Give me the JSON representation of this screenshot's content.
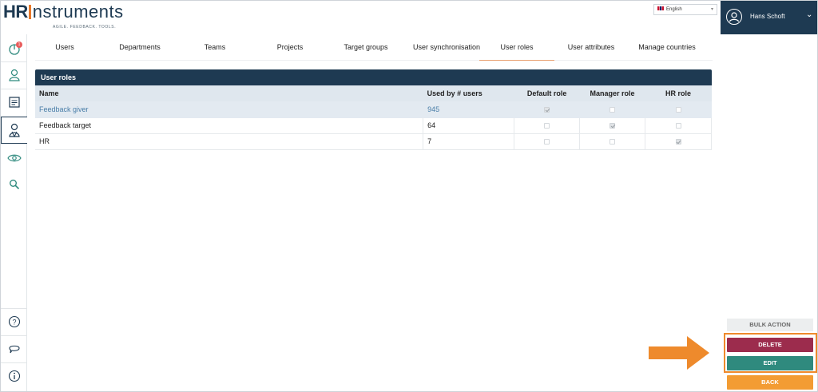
{
  "app": {
    "brand_bold": "HR",
    "brand_light": "nstruments",
    "tagline": "AGILE. FEEDBACK. TOOLS."
  },
  "language": {
    "selected": "English",
    "flag": "uk-flag-icon"
  },
  "user": {
    "name": "Hans Schoft"
  },
  "sidebar": {
    "items": [
      {
        "icon": "dashboard-icon",
        "badge": "1"
      },
      {
        "icon": "user-icon"
      },
      {
        "icon": "list-icon"
      },
      {
        "icon": "users-admin-icon",
        "active": true
      },
      {
        "icon": "eye-icon"
      },
      {
        "icon": "search-icon"
      },
      {
        "icon": "help-icon"
      },
      {
        "icon": "chat-icon"
      },
      {
        "icon": "info-icon"
      }
    ]
  },
  "tabs": [
    {
      "label": "Users"
    },
    {
      "label": "Departments"
    },
    {
      "label": "Teams"
    },
    {
      "label": "Projects"
    },
    {
      "label": "Target groups"
    },
    {
      "label": "User synchronisation"
    },
    {
      "label": "User roles",
      "active": true
    },
    {
      "label": "User attributes"
    },
    {
      "label": "Manage countries"
    }
  ],
  "table": {
    "title": "User roles",
    "columns": {
      "name": "Name",
      "used_by": "Used by # users",
      "default_role": "Default role",
      "manager_role": "Manager role",
      "hr_role": "HR role"
    },
    "rows": [
      {
        "name": "Feedback giver",
        "used_by": "945",
        "default_role": true,
        "manager_role": false,
        "hr_role": false,
        "selected": true
      },
      {
        "name": "Feedback target",
        "used_by": "64",
        "default_role": false,
        "manager_role": true,
        "hr_role": false
      },
      {
        "name": "HR",
        "used_by": "7",
        "default_role": false,
        "manager_role": false,
        "hr_role": true
      }
    ]
  },
  "actions": {
    "bulk": "BULK ACTION",
    "delete": "DELETE",
    "edit": "EDIT",
    "back": "BACK"
  },
  "colors": {
    "navy": "#1e3a52",
    "accent_orange": "#e8792b",
    "delete": "#9c2c4d",
    "edit": "#2f8a7e",
    "back": "#f39c33",
    "annotation": "#ee8a2c"
  }
}
